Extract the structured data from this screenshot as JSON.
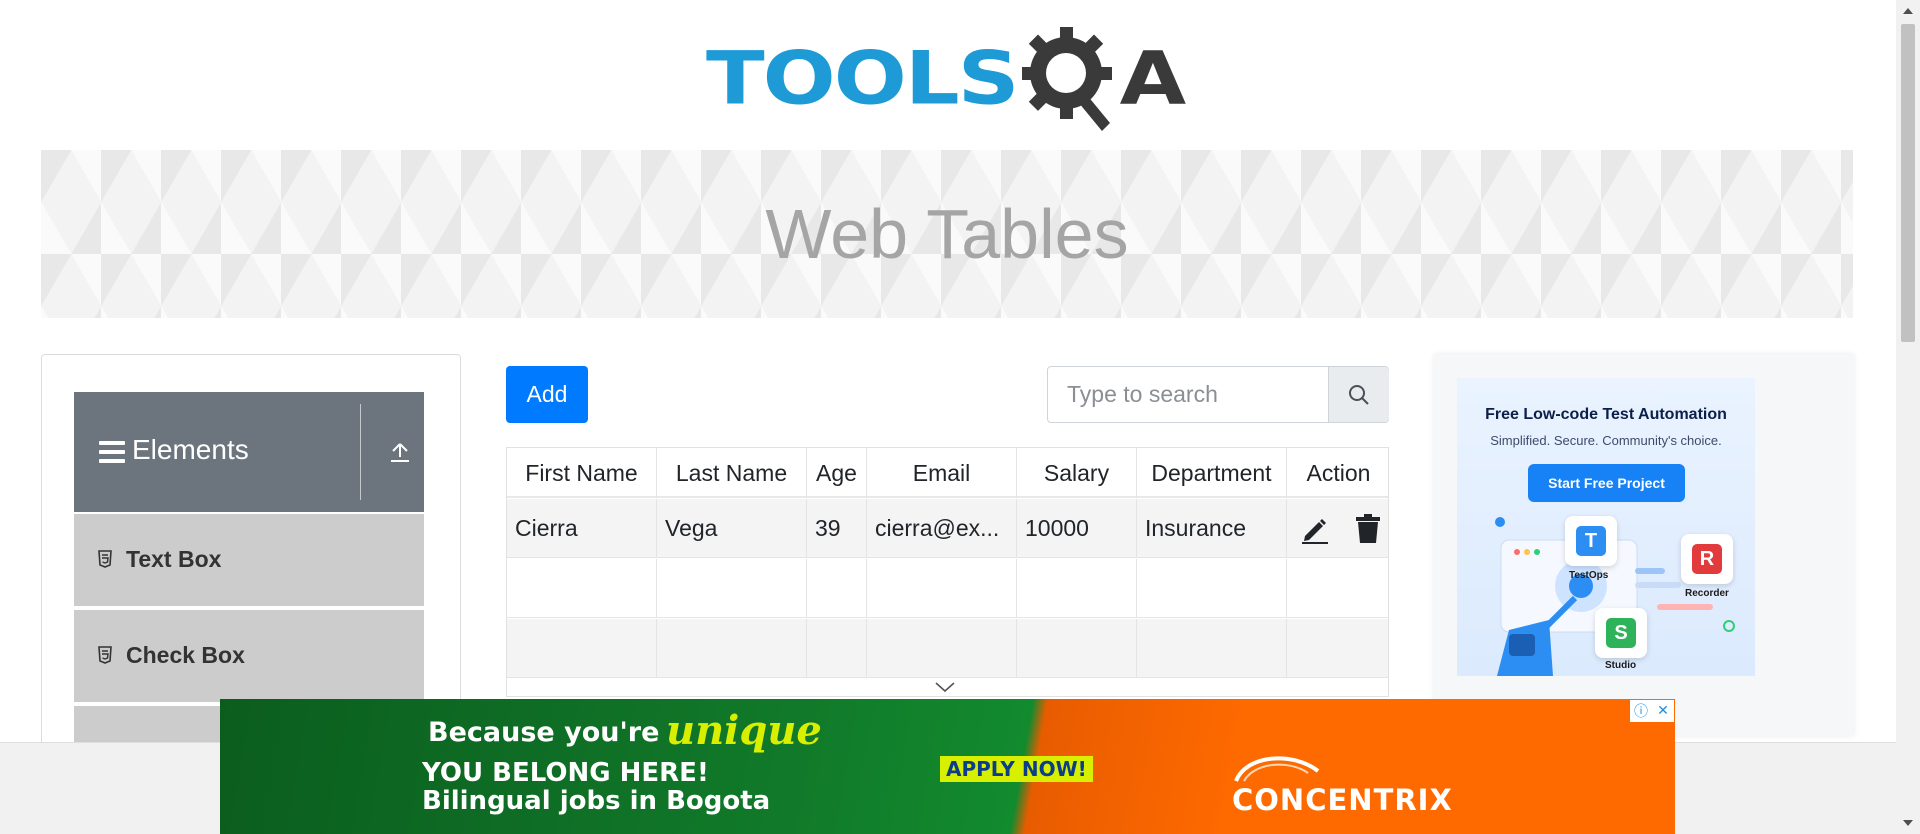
{
  "logo": {
    "text_tools": "TOOLS",
    "text_a": "A"
  },
  "banner": {
    "title": "Web Tables"
  },
  "sidebar": {
    "group": {
      "title": "Elements"
    },
    "items": [
      {
        "label": "Text Box"
      },
      {
        "label": "Check Box"
      }
    ]
  },
  "toolbar": {
    "add_label": "Add",
    "search_placeholder": "Type to search"
  },
  "table": {
    "columns": [
      "First Name",
      "Last Name",
      "Age",
      "Email",
      "Salary",
      "Department",
      "Action"
    ],
    "rows": [
      {
        "first_name": "Cierra",
        "last_name": "Vega",
        "age": "39",
        "email": "cierra@ex...",
        "salary": "10000",
        "department": "Insurance"
      }
    ]
  },
  "side_ad": {
    "headline": "Free Low-code Test Automation",
    "subtitle": "Simplified. Secure. Community's choice.",
    "cta": "Start Free Project",
    "products": [
      "TestOps",
      "Recorder",
      "Studio"
    ]
  },
  "bottom_ad": {
    "line1": "Because you're",
    "highlight": "unique",
    "line2": "YOU BELONG HERE!",
    "line3": "Bilingual jobs in Bogota",
    "cta": "APPLY NOW!",
    "brand": "CONCENTRIX"
  },
  "colors": {
    "primary_button": "#007bff",
    "sidebar_header": "#6c757d",
    "sidebar_item": "#cccccc",
    "logo_blue": "#1e9bd7"
  },
  "icons": {
    "edit": "pencil-icon",
    "delete": "trash-icon",
    "search": "search-icon",
    "group": "hamburger-icon",
    "collapse": "upload-arrow-icon"
  }
}
